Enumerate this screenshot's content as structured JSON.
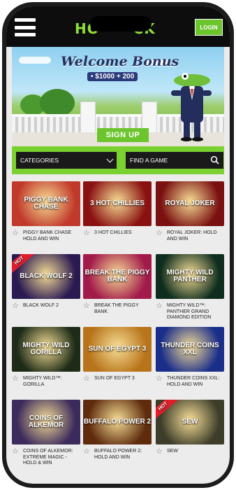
{
  "header": {
    "logo_left": "HO",
    "logo_right": "CK",
    "login_label": "LOGIN"
  },
  "hero": {
    "title": "Welcome Bonus",
    "subtitle": "• $1000 + 200",
    "cta_label": "SIGN UP"
  },
  "filters": {
    "categories_label": "CATEGORIES",
    "search_placeholder": "FIND A GAME"
  },
  "games": [
    {
      "name": "PIGGY BANK CHASE HOLD AND WIN",
      "art": "PIGGY BANK CHASE",
      "hot": false,
      "bg": "#c0392b"
    },
    {
      "name": "3 HOT CHILLIES",
      "art": "3 HOT CHILLIES",
      "hot": false,
      "bg": "#8a1111"
    },
    {
      "name": "ROYAL JOKER: HOLD AND WIN",
      "art": "ROYAL JOKER",
      "hot": false,
      "bg": "#7a1010"
    },
    {
      "name": "BLACK WOLF 2",
      "art": "BLACK WOLF 2",
      "hot": true,
      "bg": "#2b1a52"
    },
    {
      "name": "BREAK THE PIGGY BANK",
      "art": "BREAK THE PIGGY BANK",
      "hot": false,
      "bg": "#a21a4a"
    },
    {
      "name": "MIGHTY WILD™: PANTHER GRAND DIAMOND EDITION",
      "art": "MIGHTY WILD PANTHER",
      "hot": false,
      "bg": "#0e2d1e"
    },
    {
      "name": "MIGHTY WILD™: GORILLA",
      "art": "MIGHTY WILD GORILLA",
      "hot": false,
      "bg": "#1d2b17"
    },
    {
      "name": "SUN OF EGYPT 3",
      "art": "SUN OF EGYPT 3",
      "hot": false,
      "bg": "#b8741a"
    },
    {
      "name": "THUNDER COINS XXL: HOLD AND WIN",
      "art": "THUNDER COINS XXL",
      "hot": false,
      "bg": "#1b2f8a"
    },
    {
      "name": "COINS OF ALKEMOR: EXTREME MAGIC - HOLD & WIN",
      "art": "COINS OF ALKEMOR",
      "hot": false,
      "bg": "#3b2a5c"
    },
    {
      "name": "BUFFALO POWER 2: HOLD AND WIN",
      "art": "BUFFALO POWER 2",
      "hot": false,
      "bg": "#5e2b0d"
    },
    {
      "name": "SEW",
      "art": "SEW",
      "hot": true,
      "bg": "#3d3d2a"
    }
  ],
  "colors": {
    "accent": "#7bd130",
    "header_bg": "#0d0d0d",
    "page_bg": "#ececec"
  }
}
